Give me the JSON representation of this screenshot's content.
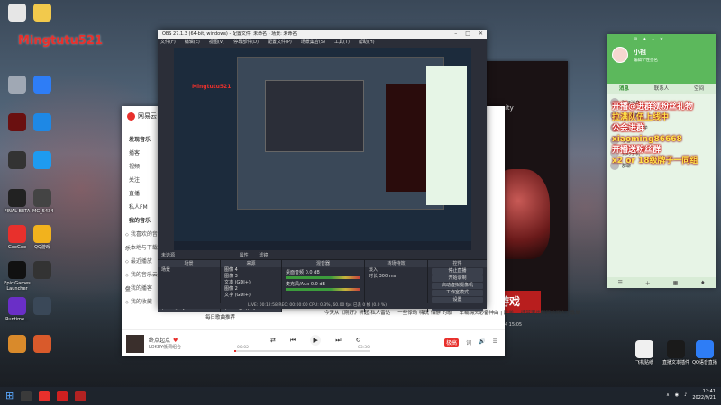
{
  "watermark": "Mingtutu521",
  "desktop_icons_left": [
    {
      "label": "",
      "color": "#e6e6e6"
    },
    {
      "label": "",
      "color": "#f2c94c"
    },
    {
      "label": "",
      "color": "#a0a8b4"
    },
    {
      "label": "",
      "color": "#2e7df6"
    },
    {
      "label": "",
      "color": "#6a1010"
    },
    {
      "label": "",
      "color": "#1e88e5"
    },
    {
      "label": "",
      "color": "#333"
    },
    {
      "label": "",
      "color": "#1e9bf0"
    },
    {
      "label": "FINAL BETA",
      "color": "#222"
    },
    {
      "label": "IMG_5434",
      "color": "#444"
    },
    {
      "label": "GeeGee",
      "color": "#e8302c"
    },
    {
      "label": "QQ游戏",
      "color": "#f2b21d"
    },
    {
      "label": "Epic Games Launcher",
      "color": "#111"
    },
    {
      "label": "",
      "color": "#333"
    },
    {
      "label": "Runtime...",
      "color": "#6a2fc7"
    },
    {
      "label": "",
      "color": "#3a4858"
    },
    {
      "label": "",
      "color": "#d98a2b"
    },
    {
      "label": "",
      "color": "#d95a2b"
    }
  ],
  "music": {
    "brand": "网易云",
    "sidebar": [
      {
        "label": "发现音乐",
        "type": "head"
      },
      {
        "label": "播客",
        "type": "item"
      },
      {
        "label": "视频",
        "type": "item"
      },
      {
        "label": "关注",
        "type": "item"
      },
      {
        "label": "直播",
        "type": "item"
      },
      {
        "label": "私人FM",
        "type": "item"
      },
      {
        "label": "我的音乐",
        "type": "head"
      },
      {
        "label": "我喜欢的音乐",
        "type": "sec"
      },
      {
        "label": "本地与下载",
        "type": "sec"
      },
      {
        "label": "最近播放",
        "type": "sec"
      },
      {
        "label": "我的音乐云盘",
        "type": "sec"
      },
      {
        "label": "我的播客",
        "type": "sec"
      },
      {
        "label": "我的收藏",
        "type": "sec"
      }
    ],
    "daily": "每日歌曲推荐",
    "lists": [
      "今天从《刚好》听起 私人雷达",
      "一些悸动 嗨玩 怕静 的歌",
      "车载嗨头必备神曲 | 欧美",
      "摔梦里出都梦的闹人 | 歌单"
    ],
    "song": "终点起点",
    "artist": "LOKEY低调组合",
    "time_current": "00:02",
    "time_total": "03:30",
    "progress": 0.01,
    "tags": [
      "极高",
      "词"
    ]
  },
  "game": {
    "unity": "unity",
    "banner": "游戏",
    "date": "2022-09-14 15:05"
  },
  "obs": {
    "title": "OBS 27.1.3 (64-bit, windows) - 配置文件: 未命名 - 场景: 未命名",
    "menu": [
      "文件(F)",
      "编辑(E)",
      "视图(V)",
      "停靠部件(D)",
      "配置文件(P)",
      "场景集合(S)",
      "工具(T)",
      "帮助(H)"
    ],
    "source_label": "未选源",
    "tab_props": "属性",
    "tab_filters": "滤镜",
    "docks": {
      "scenes": {
        "title": "场景",
        "items": [
          "场景"
        ]
      },
      "sources": {
        "title": "来源",
        "items": [
          "图像 4",
          "图像 3",
          "文本 (GDI+)",
          "图像 2",
          "文字 (GDI+)",
          "窗口采集",
          "音频"
        ]
      },
      "mixer": {
        "title": "混音器",
        "tracks": [
          {
            "name": "桌面音频",
            "db": "0.0 dB"
          },
          {
            "name": "麦克风/Aux",
            "db": "0.0 dB"
          }
        ]
      },
      "transitions": {
        "title": "转场特效",
        "type": "淡入",
        "duration_label": "时长",
        "duration": "300 ms"
      },
      "controls": {
        "title": "控件",
        "buttons": [
          "停止直播",
          "开始录制",
          "启动虚拟摄像机",
          "工作室模式",
          "设置",
          "退出"
        ]
      }
    },
    "status": "LIVE: 00:12:58   REC: 00:00:00   CPU: 0.3%, 60.00 fps   已丢 0 帧 (0.0 %)"
  },
  "qq": {
    "name": "小祖",
    "sign": "编辑个性签名",
    "tabs": [
      "消息",
      "联系人",
      "空间"
    ],
    "contacts": [
      {
        "name": "验证消息"
      },
      {
        "name": "QQ 邮箱"
      },
      {
        "name": "Rooney同学"
      },
      {
        "name": "小雪"
      },
      {
        "name": "我的手机"
      },
      {
        "name": "群聊"
      }
    ],
    "overlay": [
      "开播@进群领粉丝礼物",
      "拉满队伍上线中",
      "公会进群",
      "xiaoming86668",
      "开播送粉丝群",
      "x2 or 18级牌子一同组"
    ]
  },
  "taskbar": {
    "time": "12:41",
    "date": "2022/9/21",
    "right_apps": [
      "飞机贴纸",
      "直播文本插件",
      "QQ语音直播"
    ],
    "icon_colors": [
      "#3a3a3a",
      "#e8302c",
      "#d02020",
      "#b22222"
    ]
  }
}
